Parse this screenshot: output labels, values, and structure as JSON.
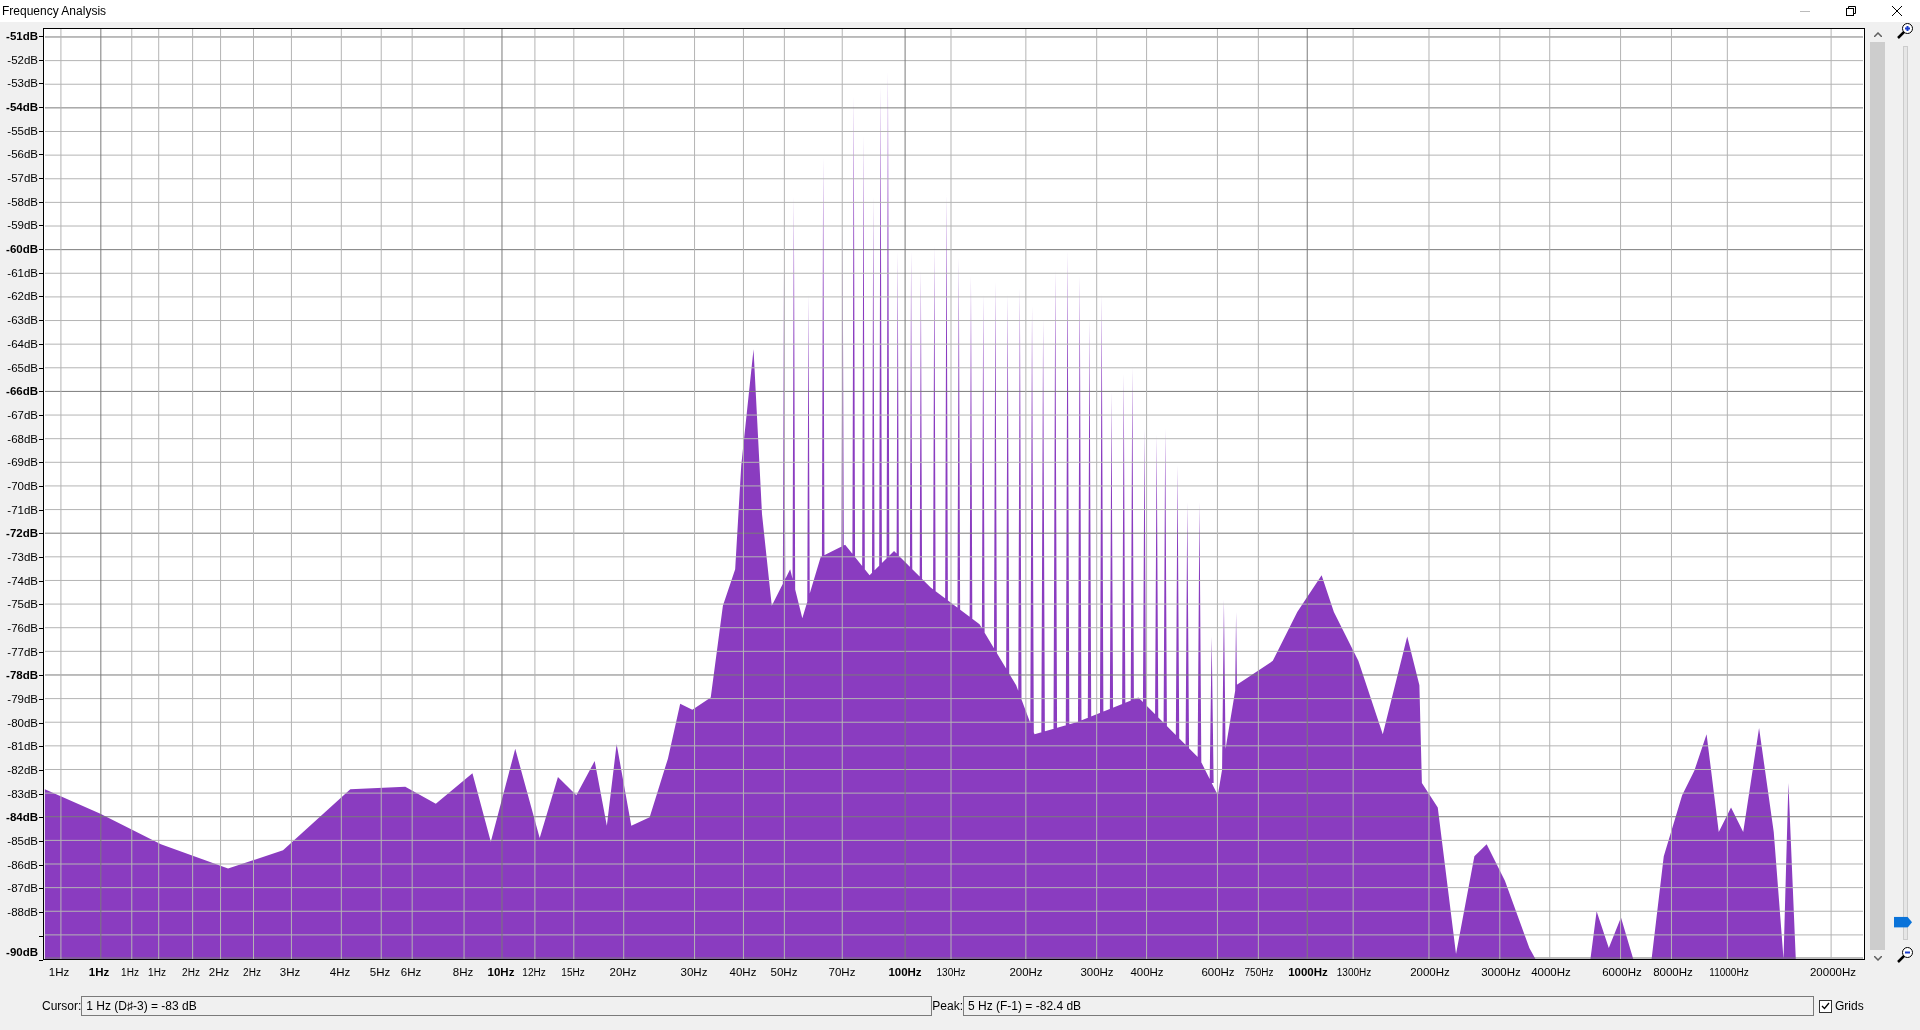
{
  "window": {
    "title": "Frequency Analysis"
  },
  "y_axis": {
    "labels": [
      {
        "text": "-51dB",
        "bold": true
      },
      {
        "text": "-52dB",
        "bold": false
      },
      {
        "text": "-53dB",
        "bold": false
      },
      {
        "text": "-54dB",
        "bold": true
      },
      {
        "text": "-55dB",
        "bold": false
      },
      {
        "text": "-56dB",
        "bold": false
      },
      {
        "text": "-57dB",
        "bold": false
      },
      {
        "text": "-58dB",
        "bold": false
      },
      {
        "text": "-59dB",
        "bold": false
      },
      {
        "text": "-60dB",
        "bold": true
      },
      {
        "text": "-61dB",
        "bold": false
      },
      {
        "text": "-62dB",
        "bold": false
      },
      {
        "text": "-63dB",
        "bold": false
      },
      {
        "text": "-64dB",
        "bold": false
      },
      {
        "text": "-65dB",
        "bold": false
      },
      {
        "text": "-66dB",
        "bold": true
      },
      {
        "text": "-67dB",
        "bold": false
      },
      {
        "text": "-68dB",
        "bold": false
      },
      {
        "text": "-69dB",
        "bold": false
      },
      {
        "text": "-70dB",
        "bold": false
      },
      {
        "text": "-71dB",
        "bold": false
      },
      {
        "text": "-72dB",
        "bold": true
      },
      {
        "text": "-73dB",
        "bold": false
      },
      {
        "text": "-74dB",
        "bold": false
      },
      {
        "text": "-75dB",
        "bold": false
      },
      {
        "text": "-76dB",
        "bold": false
      },
      {
        "text": "-77dB",
        "bold": false
      },
      {
        "text": "-78dB",
        "bold": true
      },
      {
        "text": "-79dB",
        "bold": false
      },
      {
        "text": "-80dB",
        "bold": false
      },
      {
        "text": "-81dB",
        "bold": false
      },
      {
        "text": "-82dB",
        "bold": false
      },
      {
        "text": "-83dB",
        "bold": false
      },
      {
        "text": "-84dB",
        "bold": true
      },
      {
        "text": "-85dB",
        "bold": false
      },
      {
        "text": "-86dB",
        "bold": false
      },
      {
        "text": "-87dB",
        "bold": false
      },
      {
        "text": "-88dB",
        "bold": false
      },
      {
        "text": "-90dB",
        "bold": true
      }
    ]
  },
  "x_axis": {
    "labels": [
      {
        "text": "1Hz",
        "kind": "normal"
      },
      {
        "text": "1Hz",
        "kind": "major"
      },
      {
        "text": "1Hz",
        "kind": "minor"
      },
      {
        "text": "1Hz",
        "kind": "minor"
      },
      {
        "text": "2Hz",
        "kind": "minor"
      },
      {
        "text": "2Hz",
        "kind": "normal"
      },
      {
        "text": "2Hz",
        "kind": "minor"
      },
      {
        "text": "3Hz",
        "kind": "normal"
      },
      {
        "text": "4Hz",
        "kind": "normal"
      },
      {
        "text": "5Hz",
        "kind": "normal"
      },
      {
        "text": "6Hz",
        "kind": "normal"
      },
      {
        "text": "8Hz",
        "kind": "normal"
      },
      {
        "text": "10Hz",
        "kind": "major"
      },
      {
        "text": "12Hz",
        "kind": "minor"
      },
      {
        "text": "15Hz",
        "kind": "minor"
      },
      {
        "text": "20Hz",
        "kind": "normal"
      },
      {
        "text": "30Hz",
        "kind": "normal"
      },
      {
        "text": "40Hz",
        "kind": "normal"
      },
      {
        "text": "50Hz",
        "kind": "normal"
      },
      {
        "text": "70Hz",
        "kind": "normal"
      },
      {
        "text": "100Hz",
        "kind": "major"
      },
      {
        "text": "130Hz",
        "kind": "minor"
      },
      {
        "text": "200Hz",
        "kind": "normal"
      },
      {
        "text": "300Hz",
        "kind": "normal"
      },
      {
        "text": "400Hz",
        "kind": "normal"
      },
      {
        "text": "600Hz",
        "kind": "normal"
      },
      {
        "text": "750Hz",
        "kind": "minor"
      },
      {
        "text": "1000Hz",
        "kind": "major"
      },
      {
        "text": "1300Hz",
        "kind": "minor"
      },
      {
        "text": "2000Hz",
        "kind": "normal"
      },
      {
        "text": "3000Hz",
        "kind": "normal"
      },
      {
        "text": "4000Hz",
        "kind": "normal"
      },
      {
        "text": "6000Hz",
        "kind": "normal"
      },
      {
        "text": "8000Hz",
        "kind": "normal"
      },
      {
        "text": "11000Hz",
        "kind": "minor"
      },
      {
        "text": "20000Hz",
        "kind": "normal"
      }
    ]
  },
  "zoom_slider": {
    "level": 0.02
  },
  "cursor": {
    "label": "Cursor:",
    "value": "1 Hz (D♯-3) = -83 dB"
  },
  "peak": {
    "label": "Peak:",
    "value": "5 Hz (F-1) = -82.4 dB"
  },
  "grids": {
    "label": "Grids",
    "checked": true
  }
}
